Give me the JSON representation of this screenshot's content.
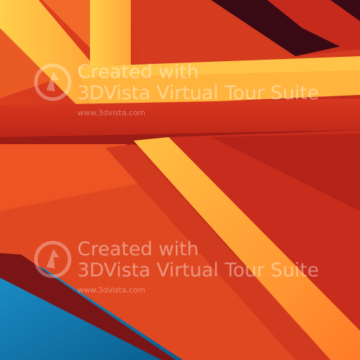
{
  "watermark": {
    "line1": "Created with",
    "line2": "3DVista Virtual Tour Suite",
    "url": "www.3dvista.com"
  },
  "palette": {
    "background": "#c8321c",
    "beam_yellow": "#ffb040",
    "beam_orange": "#ff6a1f",
    "shadow_red": "#8f1414",
    "dark_gap": "#3a0a14",
    "blue_corner": "#0f7fb6"
  },
  "icons": [
    "3dvista-logo-icon"
  ]
}
